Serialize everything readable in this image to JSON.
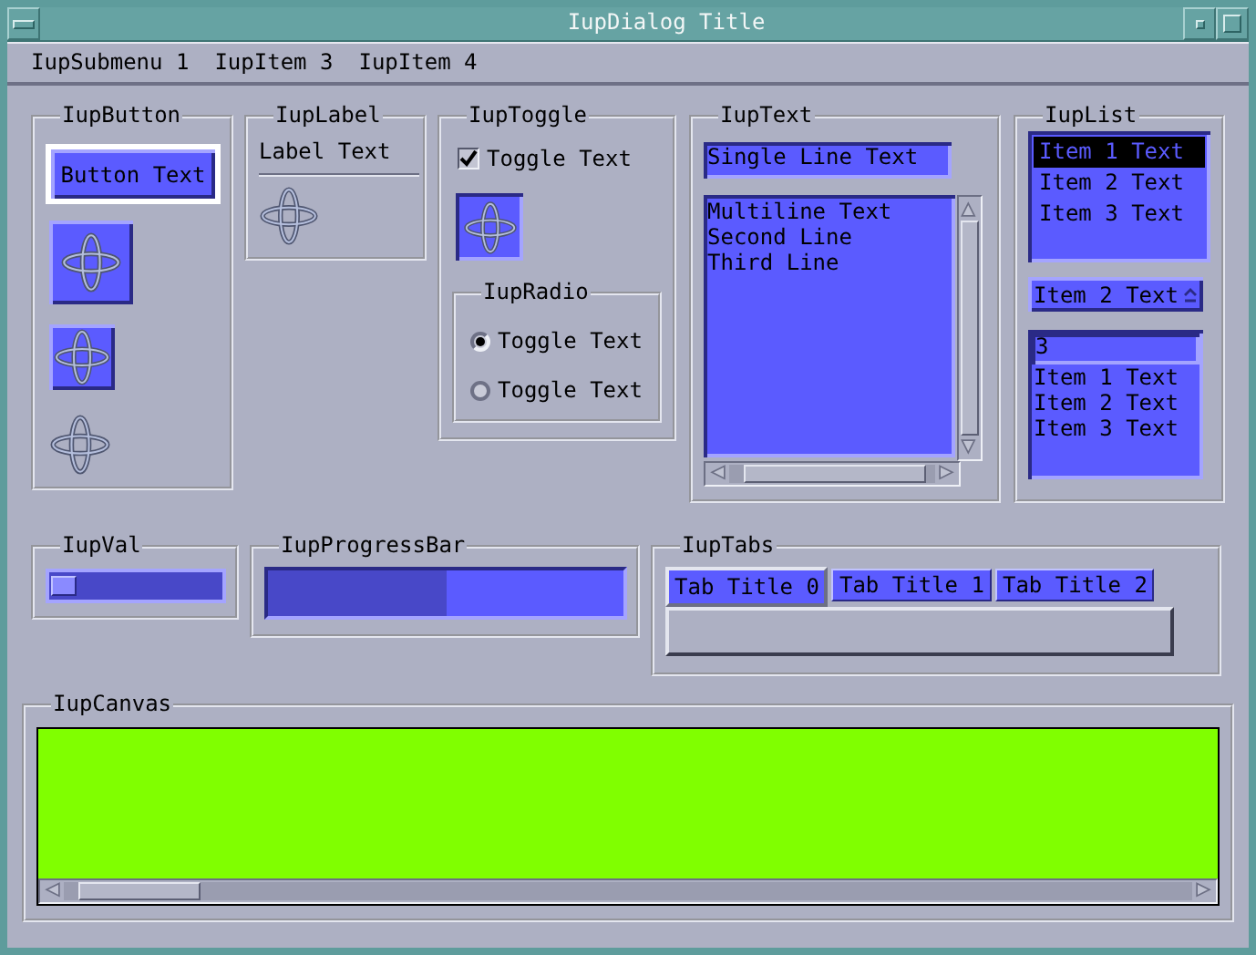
{
  "window": {
    "title": "IupDialog Title"
  },
  "menu": [
    {
      "label": "IupSubmenu 1"
    },
    {
      "label": "IupItem 3"
    },
    {
      "label": "IupItem 4"
    }
  ],
  "button_frame": {
    "title": "IupButton",
    "button": {
      "label": "Button Text",
      "focused": true
    }
  },
  "label_frame": {
    "title": "IupLabel",
    "label": "Label Text"
  },
  "toggle_frame": {
    "title": "IupToggle",
    "toggle": {
      "label": "Toggle Text",
      "checked": true
    },
    "radio": {
      "title": "IupRadio",
      "options": [
        {
          "label": "Toggle Text",
          "selected": true
        },
        {
          "label": "Toggle Text",
          "selected": false
        }
      ]
    }
  },
  "text_frame": {
    "title": "IupText",
    "single_line": {
      "value": "Single Line Text"
    },
    "multiline": {
      "value": "Multiline Text\nSecond Line\nThird Line"
    }
  },
  "list_frame": {
    "title": "IupList",
    "list": [
      {
        "label": "Item 1 Text",
        "selected": true
      },
      {
        "label": "Item 2 Text",
        "selected": false
      },
      {
        "label": "Item 3 Text",
        "selected": false
      }
    ],
    "dropdown": {
      "value": "Item 2 Text"
    },
    "combo": {
      "value": "3",
      "items": [
        "Item 1 Text",
        "Item 2 Text",
        "Item 3 Text"
      ]
    }
  },
  "val_frame": {
    "title": "IupVal",
    "level": 0
  },
  "progress_frame": {
    "title": "IupProgressBar",
    "level": 0.5
  },
  "tabs_frame": {
    "title": "IupTabs",
    "tabs": [
      {
        "label": "Tab Title 0",
        "selected": true
      },
      {
        "label": "Tab Title 1",
        "selected": false
      },
      {
        "label": "Tab Title 2",
        "selected": false
      }
    ]
  },
  "canvas_frame": {
    "title": "IupCanvas"
  }
}
